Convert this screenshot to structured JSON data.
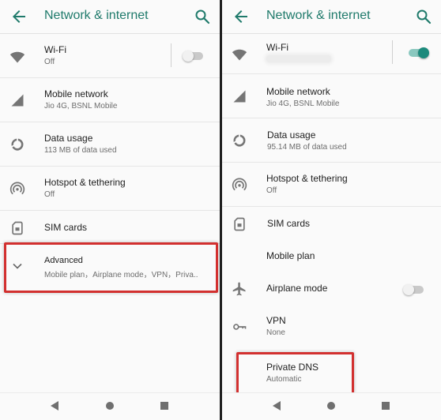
{
  "colors": {
    "accent": "#1f7a6b",
    "highlight": "#d2302f",
    "toggle_on": "#1c8a7c"
  },
  "left": {
    "title": "Network & internet",
    "wifi": {
      "label": "Wi-Fi",
      "status": "Off",
      "enabled": false,
      "icon": "wifi-icon"
    },
    "mobile": {
      "label": "Mobile network",
      "summary": "Jio 4G, BSNL Mobile",
      "icon": "signal-icon"
    },
    "data": {
      "label": "Data usage",
      "summary": "113 MB of data used",
      "icon": "data-usage-icon"
    },
    "hotspot": {
      "label": "Hotspot & tethering",
      "status": "Off",
      "icon": "hotspot-icon"
    },
    "sim": {
      "label": "SIM cards",
      "icon": "sim-card-icon"
    },
    "advanced": {
      "label": "Advanced",
      "summary": "Mobile plan，Airplane mode，VPN，Priva..",
      "icon": "chevron-down-icon"
    }
  },
  "right": {
    "title": "Network & internet",
    "wifi": {
      "label": "Wi-Fi",
      "enabled": true,
      "icon": "wifi-icon"
    },
    "mobile": {
      "label": "Mobile network",
      "summary": "Jio 4G, BSNL Mobile",
      "icon": "signal-icon"
    },
    "data": {
      "label": "Data usage",
      "summary": "95.14 MB of data used",
      "icon": "data-usage-icon"
    },
    "hotspot": {
      "label": "Hotspot & tethering",
      "status": "Off",
      "icon": "hotspot-icon"
    },
    "sim": {
      "label": "SIM cards",
      "icon": "sim-card-icon"
    },
    "mobile_plan": {
      "label": "Mobile plan"
    },
    "airplane": {
      "label": "Airplane mode",
      "enabled": false,
      "icon": "airplane-icon"
    },
    "vpn": {
      "label": "VPN",
      "status": "None",
      "icon": "vpn-key-icon"
    },
    "private_dns": {
      "label": "Private DNS",
      "status": "Automatic"
    }
  },
  "nav": {
    "icons": [
      "back-icon",
      "home-icon",
      "recents-icon"
    ]
  }
}
